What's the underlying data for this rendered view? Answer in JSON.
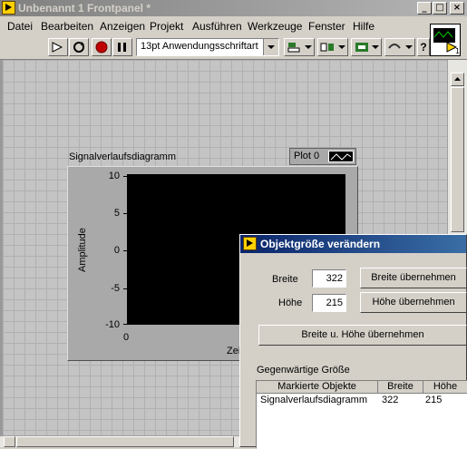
{
  "window": {
    "title": "Unbenannt 1 Frontpanel *",
    "controls": {
      "minimize": "_",
      "maximize": "□",
      "close": "×"
    }
  },
  "menu": [
    "Datei",
    "Bearbeiten",
    "Anzeigen",
    "Projekt",
    "Ausführen",
    "Werkzeuge",
    "Fenster",
    "Hilfe"
  ],
  "toolbar": {
    "font_select": "13pt Anwendungsschriftart",
    "help": "?"
  },
  "chart": {
    "label": "Signalverlaufsdiagramm",
    "legend_plot": "Plot 0",
    "ylabel": "Amplitude",
    "xlabel": "Zei",
    "yticks": [
      "10",
      "5",
      "0",
      "-5",
      "-10"
    ],
    "xtick": "0"
  },
  "chart_data": {
    "type": "line",
    "title": "",
    "ylabel": "Amplitude",
    "xlabel": "Zei",
    "ylim": [
      -10,
      10
    ],
    "yticks": [
      10,
      5,
      0,
      -5,
      -10
    ],
    "xticks": [
      0
    ],
    "series": [
      {
        "name": "Plot 0",
        "values": []
      }
    ],
    "legend": "top-right"
  },
  "dialog": {
    "title": "Objektgröße verändern",
    "width_label": "Breite",
    "width_value": "322",
    "width_button": "Breite übernehmen",
    "height_label": "Höhe",
    "height_value": "215",
    "height_button": "Höhe übernehmen",
    "both_button": "Breite u. Höhe übernehmen",
    "current_size_label": "Gegenwärtige Größe",
    "table": {
      "headers": [
        "Markierte Objekte",
        "Breite",
        "Höhe"
      ],
      "rows": [
        [
          "Signalverlaufsdiagramm",
          "322",
          "215"
        ]
      ]
    }
  },
  "colors": {
    "panel_bg": "#c4c4c4",
    "plot_bg": "#000000",
    "dialog_title": "#0a246a",
    "window_chrome": "#d4d0c8"
  }
}
